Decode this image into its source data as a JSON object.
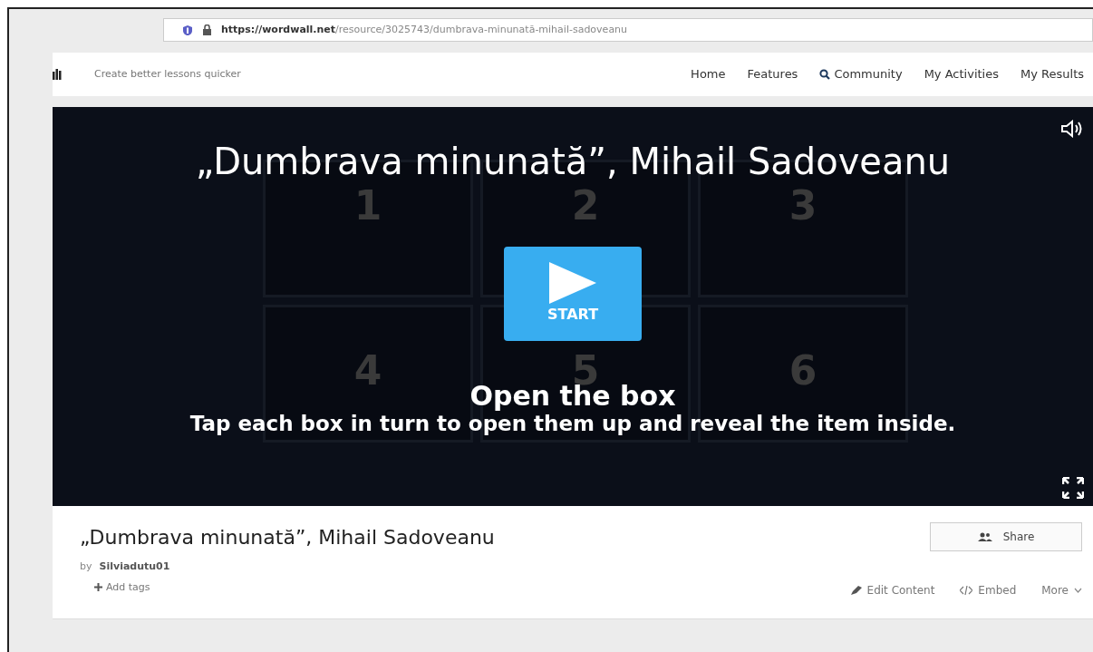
{
  "address_bar": {
    "url_host": "https://wordwall.net",
    "url_path": "/resource/3025743/dumbrava-minunată-mihail-sadoveanu"
  },
  "navbar": {
    "tagline": "Create better lessons quicker",
    "links": [
      {
        "label": "Home",
        "kind": "plain"
      },
      {
        "label": "Features",
        "kind": "plain"
      },
      {
        "label": "Community",
        "kind": "search"
      },
      {
        "label": "My Activities",
        "kind": "plain"
      },
      {
        "label": "My Results",
        "kind": "plain"
      }
    ]
  },
  "game": {
    "title": "„Dumbrava minunată”, Mihail Sadoveanu",
    "boxes": [
      "1",
      "2",
      "3",
      "4",
      "5",
      "6"
    ],
    "start_label": "START",
    "template_name": "Open the box",
    "instructions": "Tap each box in turn to open them up and reveal the item inside."
  },
  "info": {
    "title": "„Dumbrava minunată”, Mihail Sadoveanu",
    "by_label": "by",
    "author": "Silviadutu01",
    "add_tags": "Add tags",
    "share": "Share",
    "actions": [
      {
        "label": "Edit Content",
        "kind": "edit"
      },
      {
        "label": "Embed",
        "kind": "embed"
      },
      {
        "label": "More",
        "kind": "more"
      }
    ]
  }
}
